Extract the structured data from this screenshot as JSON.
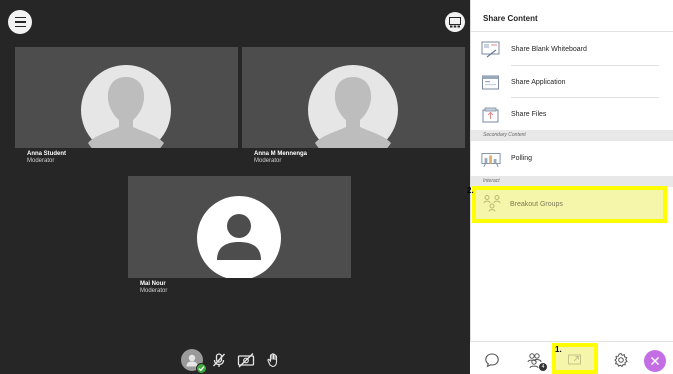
{
  "stage": {
    "participants": [
      {
        "name": "Anna Student",
        "role": "Moderator"
      },
      {
        "name": "Anna M Mennenga",
        "role": "Moderator"
      },
      {
        "name": "Mai Nour",
        "role": "Moderator"
      }
    ]
  },
  "panel": {
    "title": "Share Content",
    "primary_items": [
      {
        "label": "Share Blank Whiteboard",
        "icon": "whiteboard-icon"
      },
      {
        "label": "Share Application",
        "icon": "application-icon"
      },
      {
        "label": "Share Files",
        "icon": "files-icon"
      }
    ],
    "secondary_header": "Secondary Content",
    "secondary_items": [
      {
        "label": "Polling",
        "icon": "polling-icon"
      }
    ],
    "interact_header": "Interact",
    "interact_items": [
      {
        "label": "Breakout Groups",
        "icon": "breakout-groups-icon"
      }
    ]
  },
  "annotations": {
    "step1": "1.",
    "step2": "2."
  },
  "bottom_bar": {
    "attendee_badge": "4"
  },
  "colors": {
    "stage_bg": "#262626",
    "tile_bg": "#4d4d4d",
    "highlight": "#ffff00",
    "close_button": "#c46ee6",
    "status_green": "#3ea83e"
  }
}
